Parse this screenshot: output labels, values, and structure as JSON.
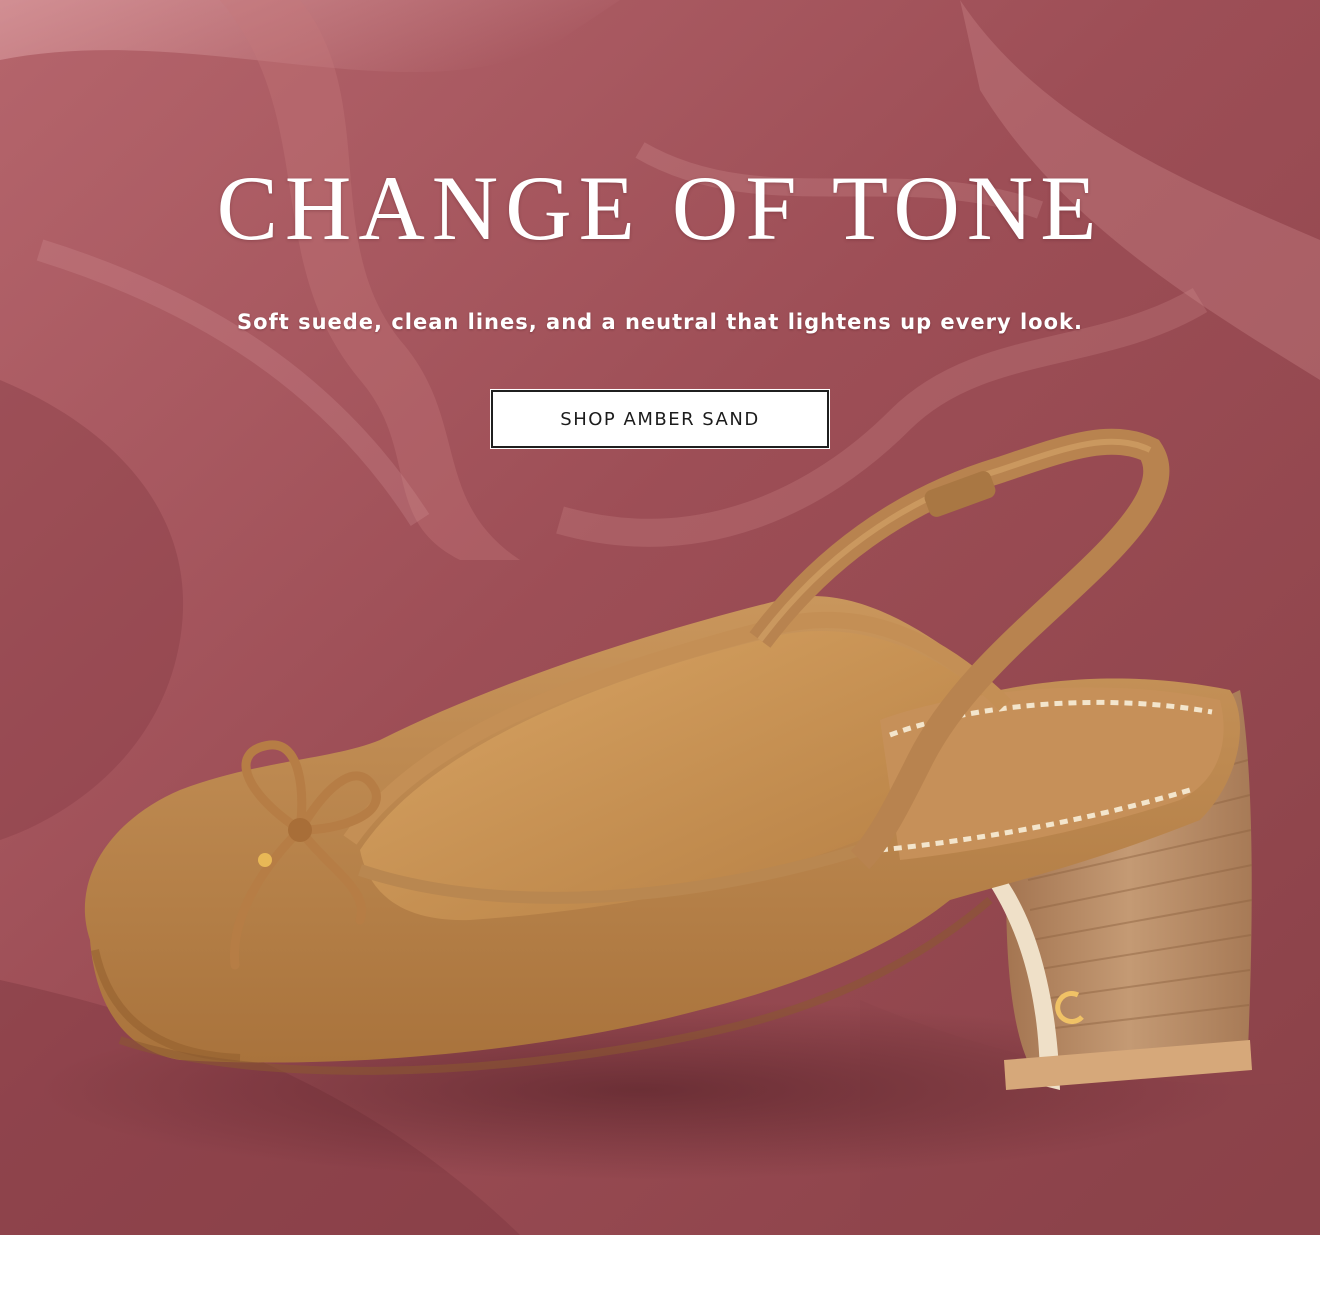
{
  "hero": {
    "headline": "CHANGE OF TONE",
    "subheadline": "Soft suede, clean lines, and a neutral that lightens up every look.",
    "cta_label": "SHOP AMBER SAND"
  },
  "colors": {
    "backdrop": "#9c5157",
    "shoe_suede": "#b8834a",
    "heel_wood": "#b98a62",
    "text": "#ffffff",
    "button_bg": "#ffffff",
    "button_text": "#1c1c1c"
  }
}
